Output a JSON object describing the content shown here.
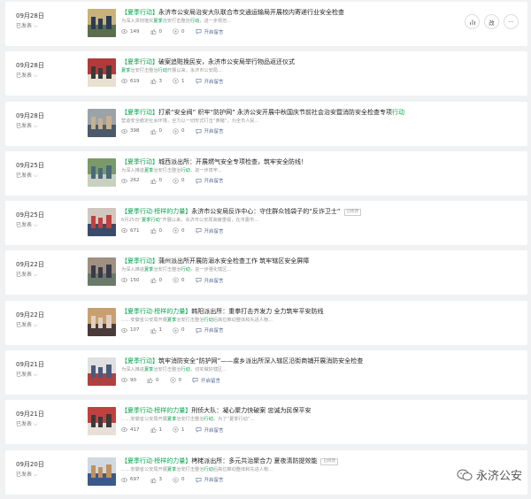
{
  "articles": [
    {
      "date": "09月28日",
      "status": "已发表",
      "tag": "【夏季行动】",
      "title": "永济市公安局治安大队联合市交通运输局开展校内寄递行业安全检查",
      "digest_pre": "为深入贯彻落实",
      "digest_hl1": "夏季",
      "digest_mid": "治安打击整治",
      "digest_hl2": "行动",
      "digest_post": "，进一步规范...",
      "views": "149",
      "likes": "0",
      "shares": "0",
      "comment_label": "开启留言",
      "badge": ""
    },
    {
      "date": "09月28日",
      "status": "已发表",
      "tag": "【夏季行动】",
      "title": "破案追赃挽民安，永济市公安局举行物品返还仪式",
      "digest_pre": "",
      "digest_hl1": "夏季",
      "digest_mid": "治安打击整治",
      "digest_hl2": "行动",
      "digest_post": "开展以来，永济市公安局...",
      "views": "619",
      "likes": "3",
      "shares": "1",
      "comment_label": "开启留言",
      "badge": ""
    },
    {
      "date": "09月28日",
      "status": "已发表",
      "tag": "【夏季行动】",
      "title": "打紧“安全阀”  织牢“防护网”  永济公安开展中秋国庆节前社会治安暨消防安全检查专项",
      "title_tail": "行动",
      "digest_pre": "",
      "digest_hl1": "",
      "digest_mid": "",
      "digest_hl2": "",
      "digest_post": "营造安全稳定社会环境，全力以一切形式打击“黄赌”，为全市人民...",
      "views": "398",
      "likes": "0",
      "shares": "0",
      "comment_label": "开启留言",
      "badge": ""
    },
    {
      "date": "09月25日",
      "status": "已发表",
      "tag": "【夏季行动】",
      "title": "城西派出所：开展燃气安全专项检查，筑牢安全防线！",
      "digest_pre": "为深入推进",
      "digest_hl1": "夏季",
      "digest_mid": "治安打击整治",
      "digest_hl2": "行动",
      "digest_post": "，进一步筑牢...",
      "views": "262",
      "likes": "0",
      "shares": "0",
      "comment_label": "开启留言",
      "badge": ""
    },
    {
      "date": "09月25日",
      "status": "已发表",
      "tag": "【夏季行动·榜样的力量】",
      "title": "永济市公安局反诈中心：守住群众钱袋子的“反诈卫士”",
      "digest_pre": "6月25日“",
      "digest_hl1": "夏季行动",
      "digest_mid": "”开展以来，永济市公安局高度重视，在市委市...",
      "digest_hl2": "",
      "digest_post": "",
      "views": "671",
      "likes": "0",
      "shares": "0",
      "comment_label": "开启留言",
      "badge": "已修改"
    },
    {
      "date": "09月22日",
      "status": "已发表",
      "tag": "【夏季行动】",
      "title": "蒲州派出所开展防溺水安全检查工作  筑牢辖区安全屏障",
      "digest_pre": "为深入推进",
      "digest_hl1": "夏季",
      "digest_mid": "治安打击整治",
      "digest_hl2": "行动",
      "digest_post": "，进一步强化辖区...",
      "views": "150",
      "likes": "0",
      "shares": "0",
      "comment_label": "开启留言",
      "badge": ""
    },
    {
      "date": "09月22日",
      "status": "已发表",
      "tag": "【夏季行动·榜样的力量】",
      "title": "韩阳派出所：重拳打击齐发力  全力筑牢平安防线",
      "digest_pre": "……安徽省公安局开展",
      "digest_hl1": "夏季",
      "digest_mid": "治安打击整治",
      "digest_hl2": "行动",
      "digest_post": "后高位推动整体和先进人物...",
      "views": "107",
      "likes": "1",
      "shares": "0",
      "comment_label": "开启留言",
      "badge": ""
    },
    {
      "date": "09月21日",
      "status": "已发表",
      "tag": "【夏季行动】",
      "title": "筑牢消防安全“防护网”——虞乡派出所深入辖区沿街商铺开展消防安全检查",
      "digest_pre": "为深入推进",
      "digest_hl1": "夏季",
      "digest_mid": "治安打击整治",
      "digest_hl2": "行动",
      "digest_post": "，切实做好辖区...",
      "views": "90",
      "likes": "0",
      "shares": "0",
      "comment_label": "开启留言",
      "badge": ""
    },
    {
      "date": "09月21日",
      "status": "已发表",
      "tag": "【夏季行动·榜样的力量】",
      "title": "刑侦大队：凝心聚力快破案  忠诚为民保平安",
      "digest_pre": "……安徽省公安局开展",
      "digest_hl1": "夏季",
      "digest_mid": "治安打击整治",
      "digest_hl2": "行动",
      "digest_post": "，为了“夏季行动”...",
      "views": "417",
      "likes": "1",
      "shares": "1",
      "comment_label": "开启留言",
      "badge": ""
    },
    {
      "date": "09月20日",
      "status": "已发表",
      "tag": "【夏季行动·榜样的力量】",
      "title": "栲栳派出所：多元共治聚合力  夏夜清防提效能",
      "digest_pre": "……安徽省公安局开展",
      "digest_hl1": "夏季",
      "digest_mid": "治安打击整治",
      "digest_hl2": "行动",
      "digest_post": "后高位推动整体和先进人物...",
      "views": "697",
      "likes": "3",
      "shares": "0",
      "comment_label": "开启留言",
      "badge": "已修改"
    }
  ],
  "row_actions": {
    "edit_label": "改",
    "more_label": "···"
  },
  "watermark": {
    "text": "永济公安"
  },
  "colors": {
    "accent": "#07a34f",
    "link": "#576b95",
    "background": "#f0f1f3"
  }
}
